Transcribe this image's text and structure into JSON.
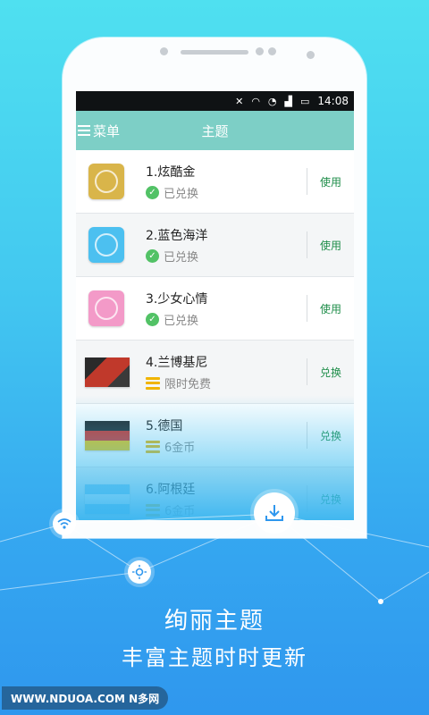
{
  "status_bar": {
    "time": "14:08"
  },
  "header": {
    "menu_label": "菜单",
    "title": "主题"
  },
  "themes": [
    {
      "name": "1.炫酷金",
      "status": "已兑换",
      "action": "使用",
      "status_type": "owned",
      "thumb_color": "#d9b54a"
    },
    {
      "name": "2.蓝色海洋",
      "status": "已兑换",
      "action": "使用",
      "status_type": "owned",
      "thumb_color": "#4cc0f0"
    },
    {
      "name": "3.少女心情",
      "status": "已兑换",
      "action": "使用",
      "status_type": "owned",
      "thumb_color": "#f39ac8"
    },
    {
      "name": "4.兰博基尼",
      "status": "限时免费",
      "action": "兑换",
      "status_type": "coin",
      "thumb_color": "#c0392b"
    },
    {
      "name": "5.德国",
      "status": "6金币",
      "action": "兑换",
      "status_type": "coin",
      "thumb_color": "#222222"
    },
    {
      "name": "6.阿根廷",
      "status": "6金币",
      "action": "兑换",
      "status_type": "coin",
      "thumb_color": "#7ec8f0"
    }
  ],
  "promo": {
    "line1": "绚丽主题",
    "line2": "丰富主题时时更新"
  },
  "watermark": "WWW.NDUOA.COM N多网",
  "colors": {
    "accent_green": "#1e8d49",
    "header_teal": "#7dcfc6",
    "coin_yellow": "#f0b400",
    "check_green": "#52c266"
  },
  "icons": [
    "wifi-icon",
    "brightness-icon",
    "download-icon"
  ]
}
